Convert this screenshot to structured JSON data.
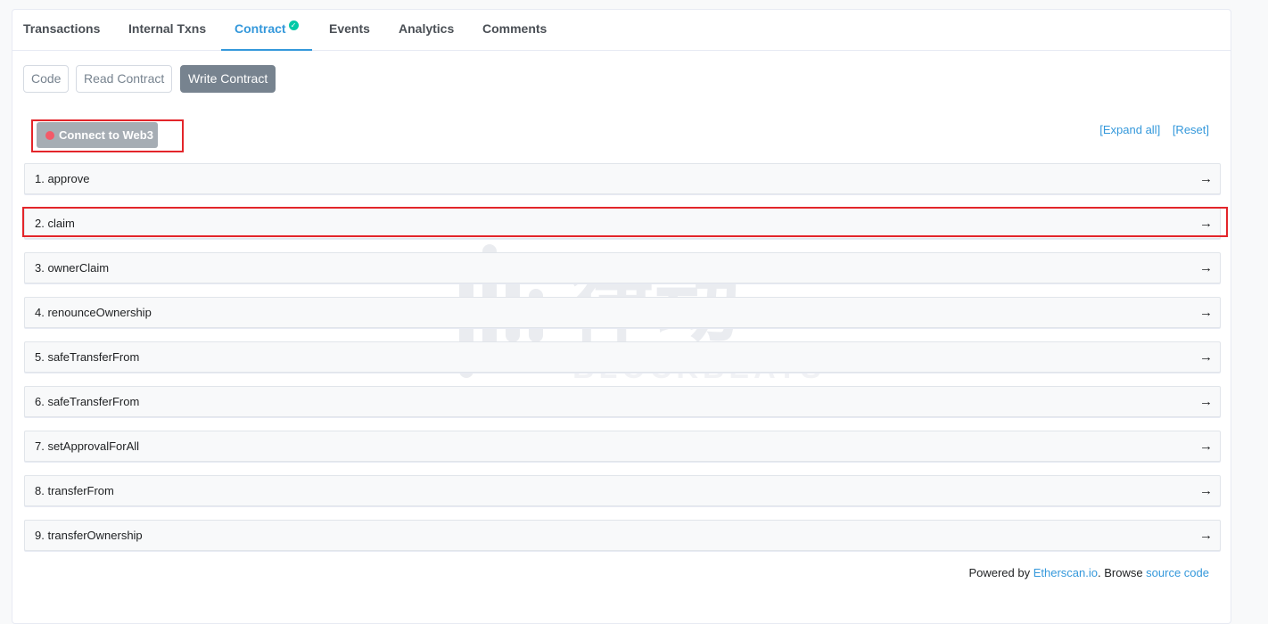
{
  "tabs": [
    "Transactions",
    "Internal Txns",
    "Contract",
    "Events",
    "Analytics",
    "Comments"
  ],
  "subtabs": [
    "Code",
    "Read Contract",
    "Write Contract"
  ],
  "connect_label": "Connect to Web3",
  "expand_all": "[Expand all]",
  "reset": "[Reset]",
  "functions": [
    "1. approve",
    "2. claim",
    "3. ownerClaim",
    "4. renounceOwnership",
    "5. safeTransferFrom",
    "6. safeTransferFrom",
    "7. setApprovalForAll",
    "8. transferFrom",
    "9. transferOwnership"
  ],
  "arrow_icon": "→",
  "check_icon": "✓",
  "footer": {
    "powered_by": "Powered by ",
    "etherscan": "Etherscan.io",
    "browse": ". Browse ",
    "source_code": "source code"
  },
  "watermark": {
    "cn": "律动",
    "en": "BLOCKBEATS"
  },
  "colors": {
    "accent": "#3498db",
    "highlight": "#e3252a",
    "status_dot": "#f35a69"
  }
}
